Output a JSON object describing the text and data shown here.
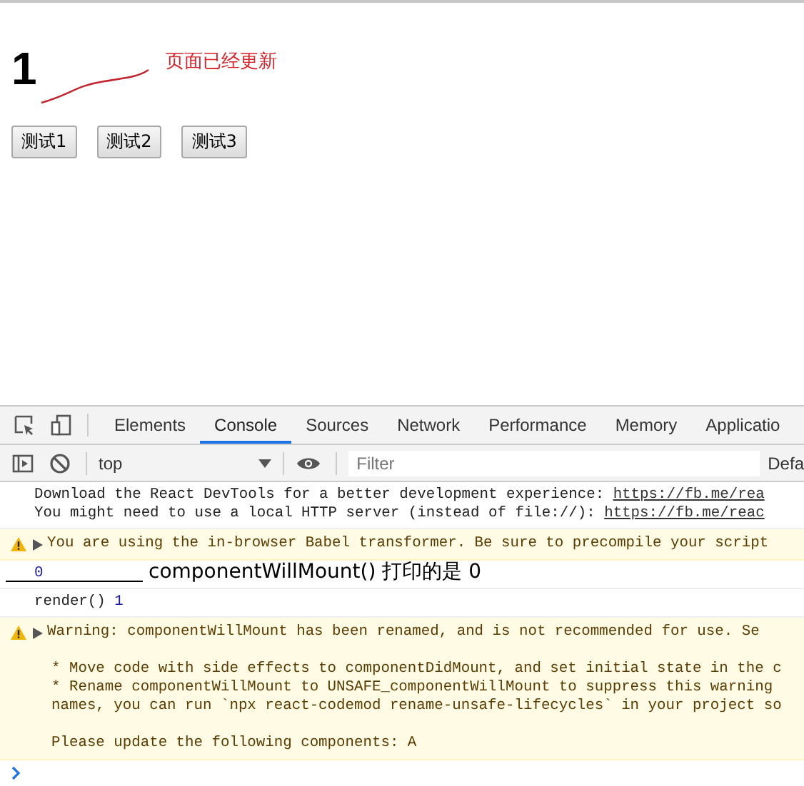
{
  "page": {
    "counter": "1",
    "note": "页面已经更新",
    "buttons": [
      "测试1",
      "测试2",
      "测试3"
    ]
  },
  "devtools": {
    "tabs": [
      {
        "label": "Elements",
        "selected": false
      },
      {
        "label": "Console",
        "selected": true
      },
      {
        "label": "Sources",
        "selected": false
      },
      {
        "label": "Network",
        "selected": false
      },
      {
        "label": "Performance",
        "selected": false
      },
      {
        "label": "Memory",
        "selected": false
      },
      {
        "label": "Applicatio",
        "selected": false
      }
    ],
    "context": "top",
    "filter": {
      "placeholder": "Filter"
    },
    "levels": "Defa",
    "messages": [
      {
        "kind": "info",
        "lines": [
          {
            "text": "Download the React DevTools for a better development experience:",
            "link": "https://fb.me/rea"
          },
          {
            "text": "You might need to use a local HTTP server (instead of file://):",
            "link": "https://fb.me/reac"
          }
        ]
      },
      {
        "kind": "warning",
        "paragraphs": [
          [
            "You are using the in-browser Babel transformer. Be sure to precompile your script"
          ]
        ]
      },
      {
        "kind": "value",
        "value": "0",
        "annotation": "componentWillMount() 打印的是 0"
      },
      {
        "kind": "log",
        "text": "render()",
        "value": "1"
      },
      {
        "kind": "warning",
        "paragraphs": [
          [
            "Warning: componentWillMount has been renamed, and is not recommended for use. Se"
          ],
          [
            "* Move code with side effects to componentDidMount, and set initial state in the c",
            "* Rename componentWillMount to UNSAFE_componentWillMount to suppress this warning",
            "names, you can run `npx react-codemod rename-unsafe-lifecycles` in your project so"
          ],
          [
            "Please update the following components: A"
          ]
        ]
      }
    ]
  }
}
